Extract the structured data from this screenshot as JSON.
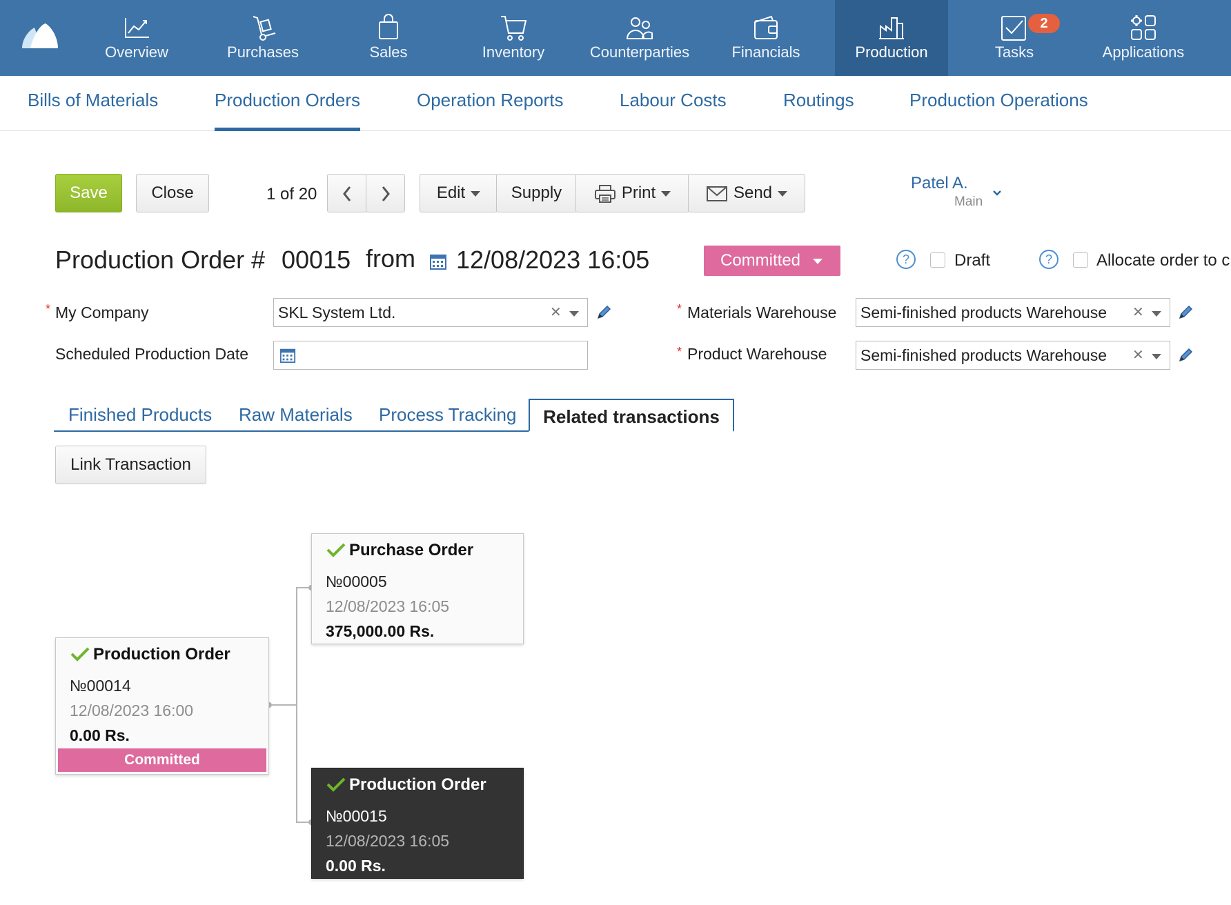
{
  "nav": {
    "items": [
      {
        "label": "Overview",
        "icon": "chart-line-icon"
      },
      {
        "label": "Purchases",
        "icon": "hand-truck-icon"
      },
      {
        "label": "Sales",
        "icon": "shopping-bag-icon"
      },
      {
        "label": "Inventory",
        "icon": "cart-icon"
      },
      {
        "label": "Counterparties",
        "icon": "people-icon"
      },
      {
        "label": "Financials",
        "icon": "wallet-icon"
      },
      {
        "label": "Production",
        "icon": "factory-icon"
      },
      {
        "label": "Tasks",
        "icon": "task-check-icon",
        "badge": "2"
      },
      {
        "label": "Applications",
        "icon": "apps-icon"
      }
    ],
    "active": "Production"
  },
  "subnav": {
    "items": [
      "Bills of Materials",
      "Production Orders",
      "Operation Reports",
      "Labour Costs",
      "Routings",
      "Production Operations"
    ],
    "active": "Production Orders"
  },
  "toolbar": {
    "save": "Save",
    "close": "Close",
    "pager": "1 of 20",
    "edit": "Edit",
    "supply": "Supply",
    "print": "Print",
    "send": "Send"
  },
  "user": {
    "name": "Patel A.",
    "role": "Main"
  },
  "document": {
    "title": "Production Order #",
    "number": "00015",
    "from": "from",
    "datetime": "12/08/2023 16:05",
    "status": "Committed",
    "draft_label": "Draft",
    "allocate_label": "Allocate order to c"
  },
  "form": {
    "company_label": "My Company",
    "company_value": "SKL System Ltd.",
    "scheduled_label": "Scheduled Production Date",
    "scheduled_value": "",
    "materials_wh_label": "Materials Warehouse",
    "materials_wh_value": "Semi-finished products Warehouse",
    "product_wh_label": "Product Warehouse",
    "product_wh_value": "Semi-finished products Warehouse"
  },
  "tabs": {
    "items": [
      "Finished Products",
      "Raw Materials",
      "Process Tracking",
      "Related transactions"
    ],
    "active": "Related transactions"
  },
  "link_transaction": "Link Transaction",
  "graph": {
    "parent": {
      "title": "Production Order",
      "number": "№00014",
      "date": "12/08/2023 16:00",
      "amount": "0.00 Rs.",
      "status": "Committed"
    },
    "children": [
      {
        "title": "Purchase Order",
        "number": "№00005",
        "date": "12/08/2023 16:05",
        "amount": "375,000.00 Rs."
      },
      {
        "title": "Production Order",
        "number": "№00015",
        "date": "12/08/2023 16:05",
        "amount": "0.00 Rs.",
        "current": true
      }
    ]
  },
  "colors": {
    "nav_bg": "#3f74a8",
    "nav_active": "#2f5f8e",
    "link": "#2d6aa3",
    "save_green": "#96c232",
    "committed_pink": "#de6a9e",
    "badge_orange": "#e4603f",
    "current_card": "#333333"
  }
}
